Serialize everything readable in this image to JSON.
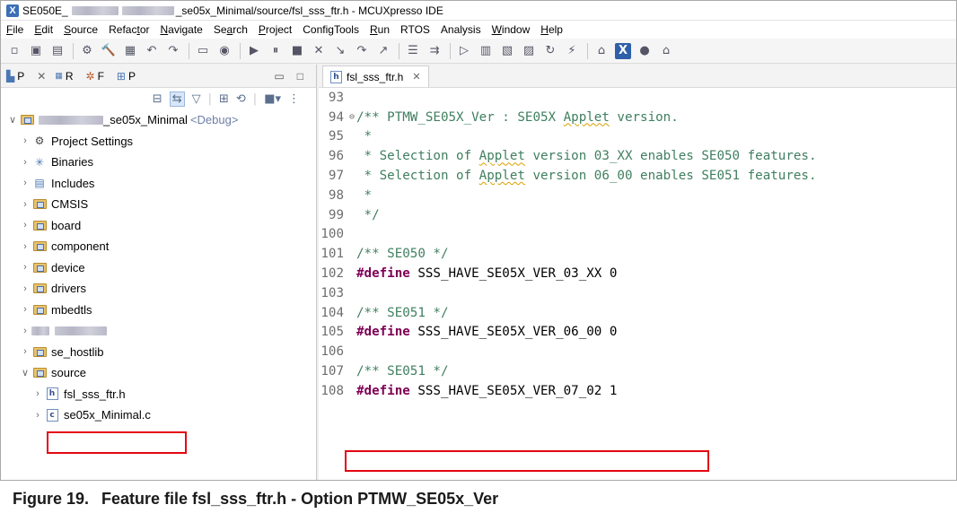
{
  "window": {
    "title_prefix": "SE050E_",
    "title_suffix": "_se05x_Minimal/source/fsl_sss_ftr.h - MCUXpresso IDE"
  },
  "menu": [
    {
      "u": "F",
      "rest": "ile"
    },
    {
      "u": "E",
      "rest": "dit"
    },
    {
      "u": "S",
      "rest": "ource"
    },
    {
      "pre": "Refac",
      "u": "t",
      "rest": "or"
    },
    {
      "u": "N",
      "rest": "avigate"
    },
    {
      "pre": "Se",
      "u": "a",
      "rest": "rch"
    },
    {
      "u": "P",
      "rest": "roject"
    },
    {
      "pre": "ConfigTools",
      "u": "",
      "rest": ""
    },
    {
      "u": "R",
      "rest": "un"
    },
    {
      "pre": "RTOS",
      "u": "",
      "rest": ""
    },
    {
      "pre": "Analysis",
      "u": "",
      "rest": ""
    },
    {
      "u": "W",
      "rest": "indow"
    },
    {
      "u": "H",
      "rest": "elp"
    }
  ],
  "left_tabs": [
    {
      "icon": "P",
      "label": "P"
    },
    {
      "icon": "R",
      "label": "R"
    },
    {
      "icon": "F",
      "label": "F"
    },
    {
      "icon": "P",
      "label": "P"
    }
  ],
  "tree": {
    "project_suffix": "_se05x_Minimal",
    "project_config": "<Debug>",
    "items": [
      {
        "label": "Project Settings",
        "icon": "settings"
      },
      {
        "label": "Binaries",
        "icon": "binaries"
      },
      {
        "label": "Includes",
        "icon": "includes"
      },
      {
        "label": "CMSIS",
        "icon": "folder"
      },
      {
        "label": "board",
        "icon": "folder"
      },
      {
        "label": "component",
        "icon": "folder"
      },
      {
        "label": "device",
        "icon": "folder"
      },
      {
        "label": "drivers",
        "icon": "folder"
      },
      {
        "label": "mbedtls",
        "icon": "folder"
      },
      {
        "label": "",
        "icon": "folder-blurred"
      },
      {
        "label": "se_hostlib",
        "icon": "folder"
      },
      {
        "label": "source",
        "icon": "folder"
      },
      {
        "label": "fsl_sss_ftr.h",
        "icon": "h-file"
      },
      {
        "label": "se05x_Minimal.c",
        "icon": "c-file"
      }
    ]
  },
  "editor": {
    "tab_label": "fsl_sss_ftr.h",
    "lines": [
      {
        "n": "93",
        "text": "",
        "kind": "blank"
      },
      {
        "n": "94",
        "fold": "⊖",
        "kind": "comment-squig",
        "pre": "/** PTMW_SE05X_Ver : SE05X ",
        "squig": "Applet",
        "post": " version."
      },
      {
        "n": "95",
        "kind": "comment",
        "text": " *"
      },
      {
        "n": "96",
        "kind": "comment-squig",
        "pre": " * Selection of ",
        "squig": "Applet",
        "post": " version 03_XX enables SE050 features."
      },
      {
        "n": "97",
        "kind": "comment-squig",
        "pre": " * Selection of ",
        "squig": "Applet",
        "post": " version 06_00 enables SE051 features."
      },
      {
        "n": "98",
        "kind": "comment",
        "text": " *"
      },
      {
        "n": "99",
        "kind": "comment",
        "text": " */"
      },
      {
        "n": "100",
        "kind": "blank",
        "text": ""
      },
      {
        "n": "101",
        "kind": "comment",
        "text": "/** SE050 */"
      },
      {
        "n": "102",
        "kind": "define",
        "kw": "#define",
        "rest": " SSS_HAVE_SE05X_VER_03_XX 0"
      },
      {
        "n": "103",
        "kind": "blank",
        "text": ""
      },
      {
        "n": "104",
        "kind": "comment",
        "text": "/** SE051 */"
      },
      {
        "n": "105",
        "kind": "define",
        "kw": "#define",
        "rest": " SSS_HAVE_SE05X_VER_06_00 0"
      },
      {
        "n": "106",
        "kind": "blank",
        "text": ""
      },
      {
        "n": "107",
        "kind": "comment",
        "text": "/** SE051 */"
      },
      {
        "n": "108",
        "kind": "define",
        "kw": "#define",
        "rest": " SSS_HAVE_SE05X_VER_07_02 1"
      }
    ]
  },
  "caption": {
    "number": "Figure 19.",
    "text": "Feature file fsl_sss_ftr.h - Option PTMW_SE05x_Ver"
  }
}
